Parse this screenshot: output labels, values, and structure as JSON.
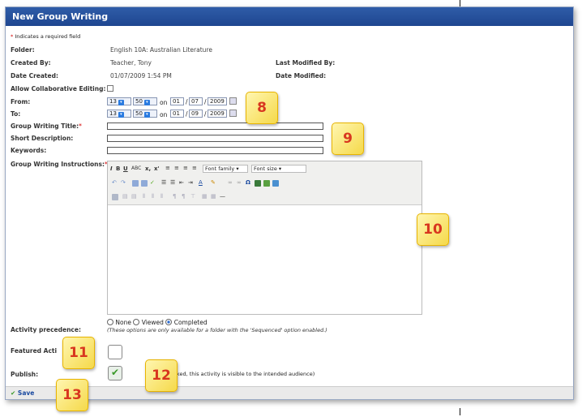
{
  "window": {
    "title": "New Group Writing"
  },
  "form": {
    "required_note": "Indicates a required field",
    "folder_label": "Folder:",
    "folder_value": "English 10A: Australian Literature",
    "created_by_label": "Created By:",
    "created_by_value": "Teacher, Tony",
    "last_modified_by_label": "Last Modified By:",
    "date_created_label": "Date Created:",
    "date_created_value": "01/07/2009 1:54 PM",
    "date_modified_label": "Date Modified:",
    "collab_label": "Allow Collaborative Editing:",
    "from_label": "From:",
    "to_label": "To:",
    "from": {
      "hour": "13",
      "minute": "50",
      "on": "on",
      "day": "01",
      "month": "07",
      "year": "2009"
    },
    "to": {
      "hour": "13",
      "minute": "50",
      "on": "on",
      "day": "01",
      "month": "09",
      "year": "2009"
    },
    "title_label": "Group Writing Title:",
    "short_desc_label": "Short Description:",
    "keywords_label": "Keywords:",
    "instructions_label": "Group Writing Instructions:",
    "precedence_label": "Activity precedence:",
    "precedence_options": [
      "None",
      "Viewed",
      "Completed"
    ],
    "precedence_selected": "Completed",
    "precedence_note": "(These options are only available for a folder with the 'Sequenced' option enabled.)",
    "featured_label": "Featured Acti",
    "publish_label": "Publish:",
    "publish_note": "ticked, this activity is visible to the intended audience)"
  },
  "editor": {
    "font_family": "Font family",
    "font_size": "Font size"
  },
  "footer": {
    "save_label": "Save"
  },
  "callouts": [
    "8",
    "9",
    "10",
    "11",
    "12",
    "13"
  ],
  "colors": {
    "titlebar": "#2f5ca8",
    "callout_fill": "#f5d94a",
    "callout_text": "#d8361f",
    "required": "#d40000"
  }
}
